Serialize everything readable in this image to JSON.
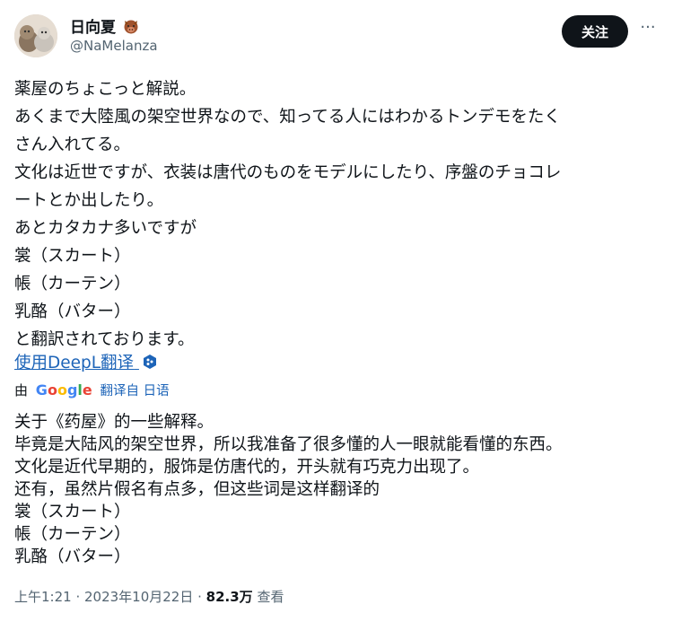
{
  "author": {
    "display_name": "日向夏",
    "handle": "@NaMelanza"
  },
  "actions": {
    "follow_label": "关注",
    "more_label": "···"
  },
  "tweet_lines": [
    "薬屋のちょこっと解説。",
    "あくまで大陸風の架空世界なので、知ってる人にはわかるトンデモをたく",
    "さん入れてる。",
    "文化は近世ですが、衣装は唐代のものをモデルにしたり、序盤のチョコレ",
    "ートとか出したり。",
    "あとカタカナ多いですが",
    "裳（スカート）",
    "帳（カーテン）",
    "乳酪（バター）",
    "と翻訳されております。"
  ],
  "translate": {
    "link_label": "使用DeepL翻译",
    "by_label": "由",
    "google_letters": [
      "G",
      "o",
      "o",
      "g",
      "l",
      "e"
    ],
    "from_label": "翻译自 日语"
  },
  "translation_lines": [
    "关于《药屋》的一些解释。",
    "毕竟是大陆风的架空世界，所以我准备了很多懂的人一眼就能看懂的东西。",
    "文化是近代早期的，服饰是仿唐代的，开头就有巧克力出现了。",
    "还有，虽然片假名有点多，但这些词是这样翻译的",
    "裳（スカート）",
    "帳（カーテン）",
    "乳酪（バター）"
  ],
  "meta": {
    "time": "上午1:21 · 2023年10月22日 · ",
    "views_count": "82.3万",
    "views_label": "查看"
  },
  "icons": {
    "avatar": "avatar-cats-illustration",
    "name_emoji": "boar-face-icon",
    "more": "more-dots-icon",
    "deepl": "deepl-badge-icon"
  }
}
